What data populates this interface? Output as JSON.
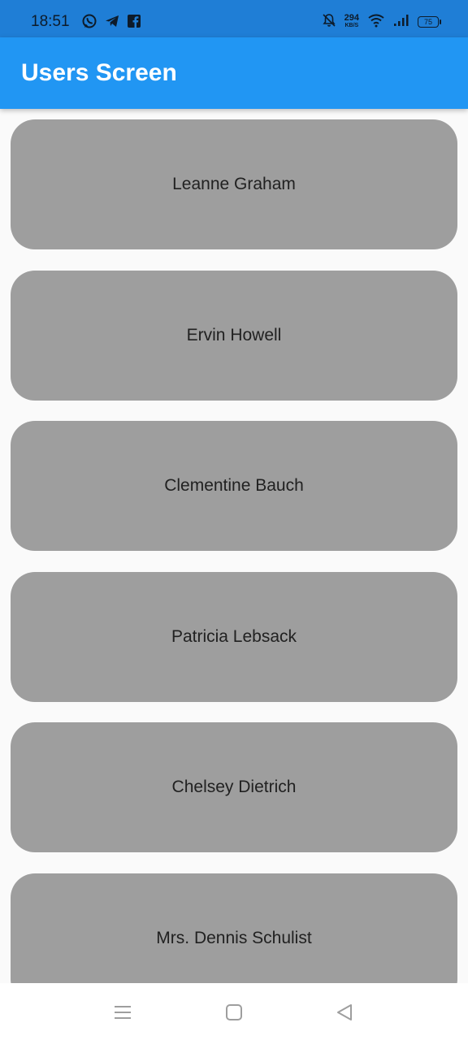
{
  "status_bar": {
    "time": "18:51",
    "speed_value": "294",
    "speed_unit": "KB/S",
    "battery": "75",
    "icons": [
      "whatsapp-icon",
      "telegram-icon",
      "facebook-icon",
      "mute-bell-icon",
      "wifi-icon",
      "signal-icon",
      "battery-icon"
    ]
  },
  "app_bar": {
    "title": "Users Screen",
    "color": "#2196f3"
  },
  "users": [
    "Leanne Graham",
    "Ervin Howell",
    "Clementine Bauch",
    "Patricia Lebsack",
    "Chelsey Dietrich",
    "Mrs. Dennis Schulist"
  ],
  "colors": {
    "card": "#9e9e9e",
    "background": "#fafafa",
    "status_bar": "#1f7ed6"
  },
  "nav_bar": {
    "icons": [
      "menu-icon",
      "home-square-icon",
      "back-triangle-icon"
    ]
  }
}
